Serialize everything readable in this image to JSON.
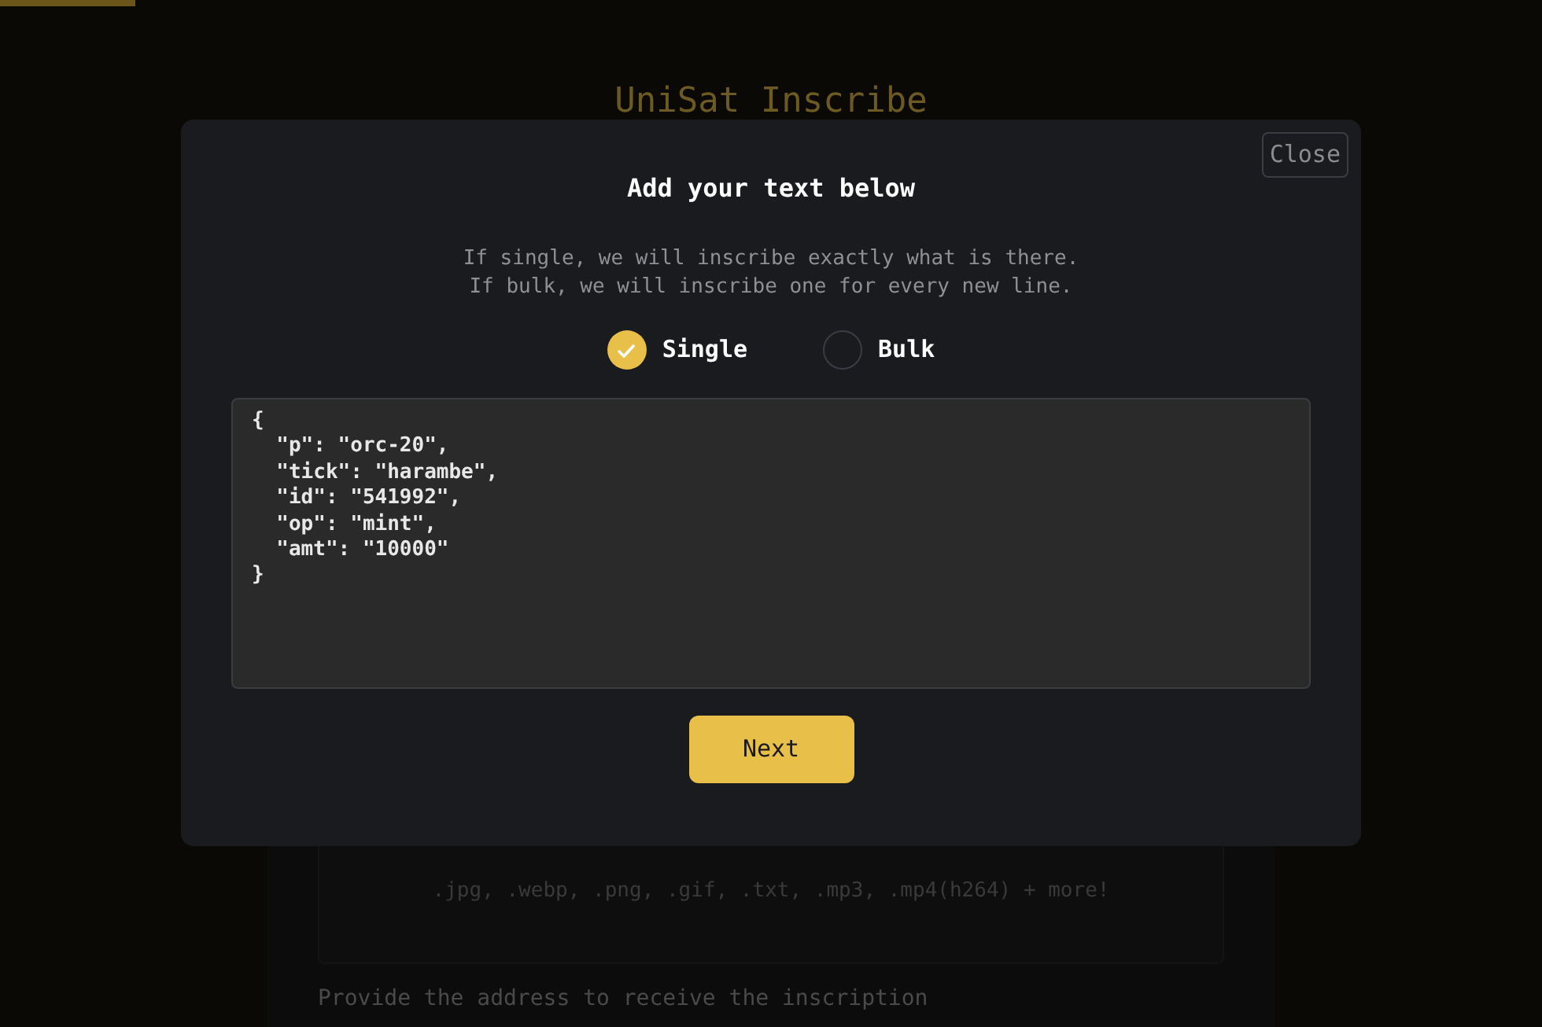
{
  "progress": {
    "level": 0.088
  },
  "page": {
    "title": "UniSat Inscribe",
    "formats": ".jpg, .webp, .png, .gif, .txt, .mp3, .mp4(h264) + more!",
    "address_prompt": "Provide the address to receive the inscription"
  },
  "dialog": {
    "close": "Close",
    "title": "Add your text below",
    "description": [
      "If single, we will inscribe exactly what is there.",
      "If bulk, we will inscribe one for every new line."
    ],
    "options": [
      {
        "label": "Single",
        "selected": true
      },
      {
        "label": "Bulk",
        "selected": false
      }
    ],
    "text_value": "{\n  \"p\": \"orc-20\",\n  \"tick\": \"harambe\",\n  \"id\": \"541992\",\n  \"op\": \"mint\",\n  \"amt\": \"10000\"\n}",
    "next": "Next"
  }
}
